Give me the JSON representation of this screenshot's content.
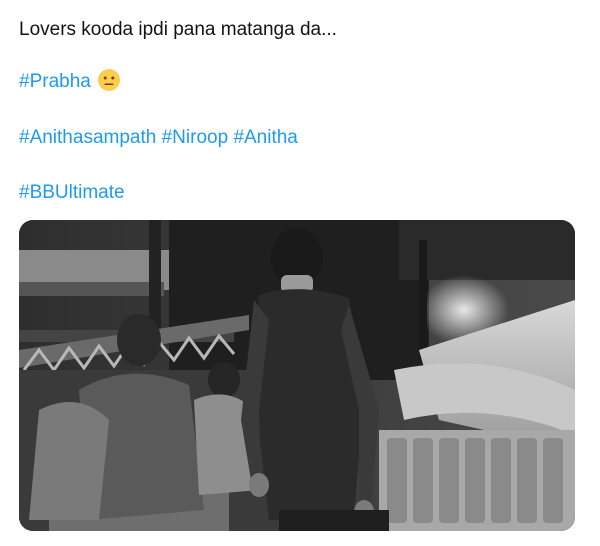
{
  "tweet": {
    "text": "Lovers kooda ipdi pana matanga da...",
    "hashtags": {
      "prabha": "#Prabha",
      "anithasampath": "#Anithasampath",
      "niroop": "#Niroop",
      "anitha": "#Anitha",
      "bbultimate": "#BBUltimate"
    },
    "emoji": "neutral-face-emoji"
  },
  "colors": {
    "hashtag": "#1d9bf0",
    "text": "#0f1419"
  },
  "media": {
    "type": "photo",
    "style": "grayscale"
  }
}
